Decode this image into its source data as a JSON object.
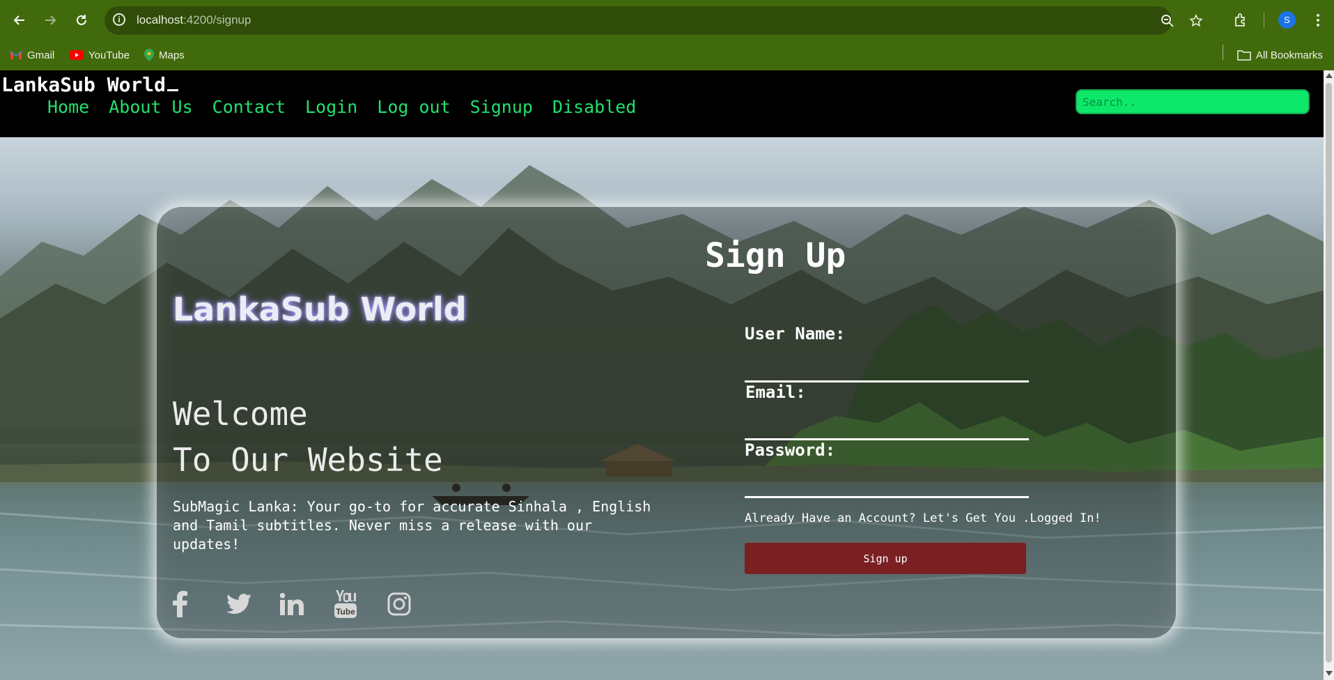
{
  "browser": {
    "url_host": "localhost",
    "url_port_path": ":4200/signup",
    "profile_initial": "S",
    "bookmarks": [
      {
        "label": "Gmail",
        "icon": "gmail-icon"
      },
      {
        "label": "YouTube",
        "icon": "youtube-icon"
      },
      {
        "label": "Maps",
        "icon": "maps-icon"
      }
    ],
    "all_bookmarks_label": "All Bookmarks"
  },
  "site": {
    "brand": "LankaSub World",
    "nav": [
      "Home",
      "About Us",
      "Contact",
      "Login",
      "Log out",
      "Signup",
      "Disabled"
    ],
    "search_placeholder": "Search.."
  },
  "card": {
    "title": "LankaSub World",
    "welcome_line1": "Welcome",
    "welcome_line2": "To Our Website",
    "description": "SubMagic Lanka: Your go-to for accurate Sinhala , English and Tamil subtitles. Never miss a release with our updates!",
    "socials": [
      "facebook-icon",
      "twitter-icon",
      "linkedin-icon",
      "youtube-icon",
      "instagram-icon"
    ]
  },
  "form": {
    "title": "Sign Up",
    "username_label": "User Name:",
    "email_label": "Email:",
    "password_label": "Password:",
    "username_value": "",
    "email_value": "",
    "password_value": "",
    "already_text": "Already Have an Account? Let's Get You .Logged In!",
    "submit_label": "Sign up"
  },
  "colors": {
    "chrome_bg": "#416a0c",
    "nav_link": "#22e06e",
    "search_bg": "#0ee86a",
    "button_bg": "#7a1f22"
  }
}
